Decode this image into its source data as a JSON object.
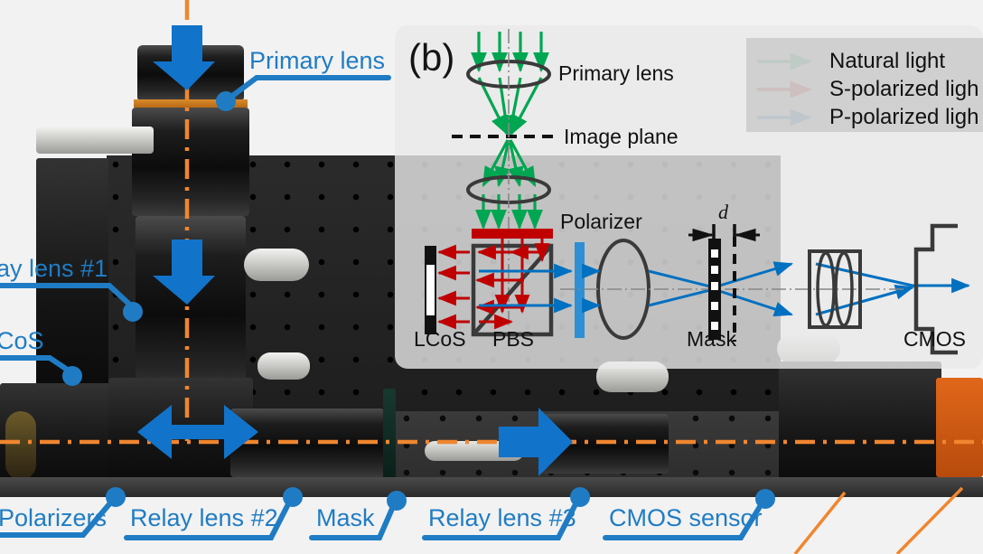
{
  "figure": {
    "panel_tag": "(b)",
    "colors": {
      "callout_blue": "#1F7CC4",
      "arrow_blue": "#1273CA",
      "axis_orange": "#F0862F",
      "natural_light_green": "#00A651",
      "s_polarized_red": "#C00000",
      "p_polarized_blue": "#0070C0",
      "schematic_outline": "#3A3A3A"
    }
  },
  "legend": {
    "entries": [
      {
        "label": "Natural light",
        "color": "#00A651"
      },
      {
        "label": "S-polarized ligh",
        "color": "#C00000"
      },
      {
        "label": "P-polarized ligh",
        "color": "#0070C0"
      }
    ]
  },
  "schematic": {
    "labels": {
      "primary_lens": "Primary lens",
      "image_plane": "Image plane",
      "polarizer": "Polarizer",
      "lcos": "LCoS",
      "pbs": "PBS",
      "mask": "Mask",
      "cmos": "CMOS",
      "gap": "d"
    }
  },
  "photo_callouts": [
    {
      "name": "primary-lens",
      "text": "Primary lens"
    },
    {
      "name": "relay-lens-1",
      "text": "ay lens #1"
    },
    {
      "name": "lcos",
      "text": "CoS"
    },
    {
      "name": "polarizers",
      "text": "Polarizers"
    },
    {
      "name": "relay-lens-2",
      "text": "Relay lens #2"
    },
    {
      "name": "mask",
      "text": "Mask"
    },
    {
      "name": "relay-lens-3",
      "text": "Relay lens #3"
    },
    {
      "name": "cmos-sensor",
      "text": "CMOS sensor"
    }
  ]
}
